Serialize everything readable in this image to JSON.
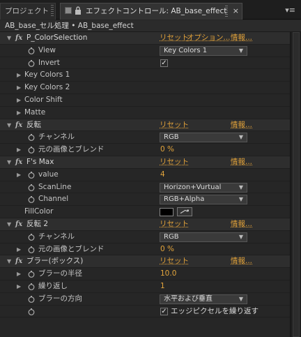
{
  "tabs": {
    "project_label": "プロジェクト",
    "effect_label": "エフェクトコントロール: AB_base_effect",
    "close_glyph": "×",
    "menu_glyph": "▾≡"
  },
  "breadcrumb": "AB_base_セル処理 • AB_base_effect",
  "effects": [
    {
      "name": "P_ColorSelection",
      "reset": "リセット",
      "options": "オプション...",
      "about": "情報...",
      "props": [
        {
          "label": "View",
          "type": "dropdown",
          "value": "Key Colors 1"
        },
        {
          "label": "Invert",
          "type": "checkbox",
          "checked": true,
          "checklabel": ""
        },
        {
          "label": "Key Colors 1",
          "type": "group"
        },
        {
          "label": "Key Colors 2",
          "type": "group"
        },
        {
          "label": "Color Shift",
          "type": "group"
        },
        {
          "label": "Matte",
          "type": "group"
        }
      ]
    },
    {
      "name": "反転",
      "reset": "リセット",
      "about": "情報...",
      "props": [
        {
          "label": "チャンネル",
          "type": "dropdown",
          "value": "RGB"
        },
        {
          "label": "元の画像とブレンド",
          "type": "value",
          "value": "0 %"
        }
      ]
    },
    {
      "name": "F's Max",
      "reset": "リセット",
      "about": "情報...",
      "props": [
        {
          "label": "value",
          "type": "value",
          "value": "4"
        },
        {
          "label": "ScanLine",
          "type": "dropdown",
          "value": "Horizon+Vurtual"
        },
        {
          "label": "Channel",
          "type": "dropdown",
          "value": "RGB+Alpha"
        },
        {
          "label": "FillColor",
          "type": "color",
          "value": "#000000"
        }
      ]
    },
    {
      "name": "反転 2",
      "reset": "リセット",
      "about": "情報...",
      "props": [
        {
          "label": "チャンネル",
          "type": "dropdown",
          "value": "RGB"
        },
        {
          "label": "元の画像とブレンド",
          "type": "value",
          "value": "0 %"
        }
      ]
    },
    {
      "name": "ブラー(ボックス)",
      "reset": "リセット",
      "about": "情報...",
      "props": [
        {
          "label": "ブラーの半径",
          "type": "value",
          "value": "10.0"
        },
        {
          "label": "繰り返し",
          "type": "value",
          "value": "1"
        },
        {
          "label": "ブラーの方向",
          "type": "dropdown",
          "value": "水平および垂直"
        },
        {
          "label": "",
          "type": "checkbox",
          "checked": true,
          "checklabel": "エッジピクセルを繰り返す"
        }
      ]
    }
  ],
  "colors": {
    "accent_orange": "#e0a13a",
    "panel_bg": "#262626",
    "effect_row_bg": "#2e2e2e"
  }
}
